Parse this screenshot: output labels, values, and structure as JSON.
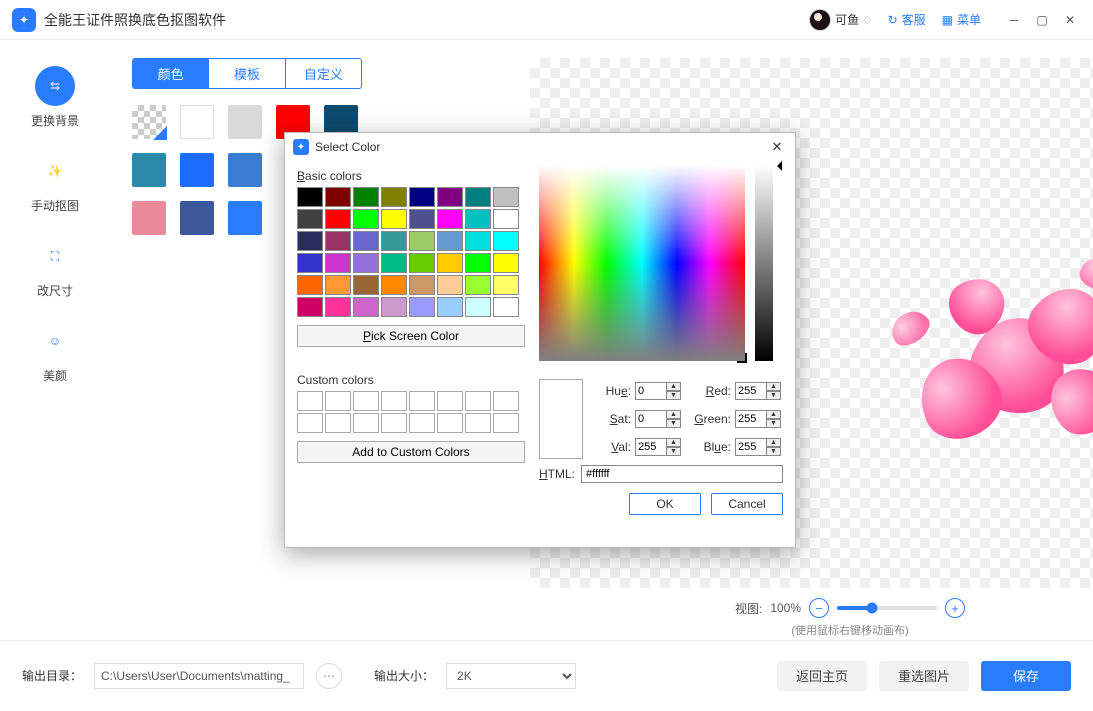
{
  "titlebar": {
    "app_name": "全能王证件照换底色抠图软件",
    "user_name": "可鱼",
    "support": "客服",
    "menu": "菜单"
  },
  "sidebar": {
    "items": [
      {
        "label": "更换背景",
        "icon": "swap-icon"
      },
      {
        "label": "手动抠图",
        "icon": "wand-icon"
      },
      {
        "label": "改尺寸",
        "icon": "resize-icon"
      },
      {
        "label": "美颜",
        "icon": "beauty-icon"
      }
    ]
  },
  "tabs": {
    "color": "颜色",
    "template": "模板",
    "custom": "自定义"
  },
  "swatches": [
    "checker",
    "#ffffff",
    "#d9d9d9",
    "#ff0000",
    "#0d4a6e",
    "#2a8aa8",
    "#1b6cff",
    "#3a7bd5",
    "#000000",
    "#000000",
    "#e98a9a",
    "#3b5998",
    "#2a7cff",
    "#000000",
    "#000000"
  ],
  "view": {
    "label": "视图:",
    "value": "100%",
    "hint": "(使用鼠标右键移动画布)"
  },
  "footer": {
    "out_dir_label": "输出目录：",
    "out_dir": "C:\\Users\\User\\Documents\\matting_",
    "out_size_label": "输出大小：",
    "out_size": "2K",
    "back": "返回主页",
    "reset": "重选图片",
    "save": "保存"
  },
  "modal": {
    "title": "Select Color",
    "basic_label": "Basic colors",
    "pick_btn": "Pick Screen Color",
    "custom_label": "Custom colors",
    "add_btn": "Add to Custom Colors",
    "basic_colors": [
      "#000000",
      "#800000",
      "#008000",
      "#808000",
      "#000080",
      "#800080",
      "#008080",
      "#c0c0c0",
      "#404040",
      "#ff0000",
      "#00ff00",
      "#ffff00",
      "#4f4f8f",
      "#ff00ff",
      "#00c0c0",
      "#ffffff",
      "#2b2b60",
      "#993366",
      "#6666cc",
      "#339999",
      "#99cc66",
      "#6699cc",
      "#00dddd",
      "#00ffff",
      "#3333cc",
      "#cc33cc",
      "#9370db",
      "#00bb88",
      "#66cc00",
      "#ffcc00",
      "#00ff00",
      "#ffff00",
      "#ff6600",
      "#ff9933",
      "#996633",
      "#ff8800",
      "#cc9966",
      "#ffcc99",
      "#99ff33",
      "#ffff66",
      "#cc0066",
      "#ff3399",
      "#cc66cc",
      "#cc99cc",
      "#9999ff",
      "#99ccff",
      "#ccffff",
      "#ffffff"
    ],
    "hue_l": "Hue:",
    "sat_l": "Sat:",
    "val_l": "Val:",
    "red_l": "Red:",
    "green_l": "Green:",
    "blue_l": "Blue:",
    "html_l": "HTML:",
    "hue": "0",
    "sat": "0",
    "val": "255",
    "red": "255",
    "green": "255",
    "blue": "255",
    "html": "#ffffff",
    "ok": "OK",
    "cancel": "Cancel"
  }
}
